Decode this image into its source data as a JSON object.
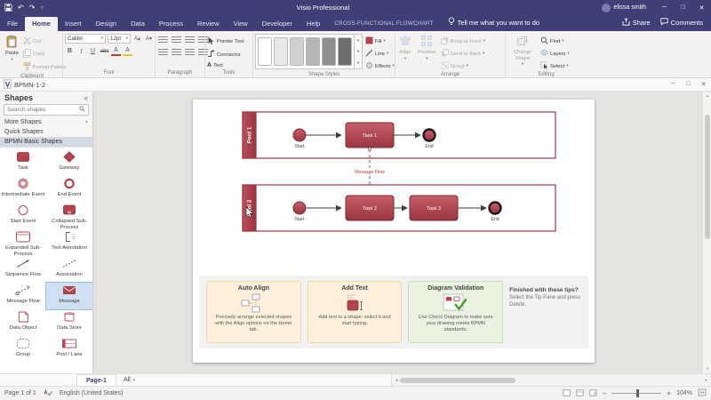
{
  "colors": {
    "accent": "#3f3e75",
    "bpmn_red": "#b5434e",
    "canvas_bg": "#e5e3e0",
    "tip_orange_bg": "#fcefdc",
    "tip_green_bg": "#e9f3df"
  },
  "title_bar": {
    "app_title": "Visio Professional",
    "user_name": "elissa smith"
  },
  "tabs": {
    "file": "File",
    "items": [
      "Home",
      "Insert",
      "Design",
      "Data",
      "Process",
      "Review",
      "View",
      "Developer",
      "Help"
    ],
    "contextual": "CROSS-FUNCTIONAL FLOWCHART",
    "tell_me": "Tell me what you want to do",
    "share": "Share",
    "comments": "Comments"
  },
  "ribbon": {
    "clipboard": {
      "label": "Clipboard",
      "paste": "Paste",
      "cut": "Cut",
      "copy": "Copy",
      "format_painter": "Format Painter"
    },
    "font": {
      "label": "Font",
      "family": "Calibri",
      "size": "12pt",
      "bold": "B",
      "italic": "I",
      "underline": "U",
      "strike": "abc",
      "color_a": "A"
    },
    "paragraph": {
      "label": "Paragraph"
    },
    "tools": {
      "label": "Tools",
      "pointer": "Pointer Tool",
      "connector": "Connector",
      "text": "Text"
    },
    "shape_styles": {
      "label": "Shape Styles",
      "fill": "Fill",
      "line": "Line",
      "effects": "Effects"
    },
    "arrange": {
      "label": "Arrange",
      "align": "Align",
      "position": "Position",
      "bring_to_front": "Bring to Front",
      "send_to_back": "Send to Back",
      "group": "Group"
    },
    "editing": {
      "label": "Editing",
      "change_shape": "Change Shape",
      "find": "Find",
      "layers": "Layers",
      "select": "Select"
    }
  },
  "doc_window": {
    "title": "BPMN-1-2"
  },
  "shapes_panel": {
    "title": "Shapes",
    "search_placeholder": "Search shapes",
    "more_shapes": "More Shapes",
    "quick_shapes": "Quick Shapes",
    "stencil_title": "BPMN Basic Shapes",
    "items": [
      "Task",
      "Gateway",
      "Intermediate Event",
      "End Event",
      "Start Event",
      "Collapsed Sub-Process",
      "Expanded Sub-Process",
      "Text Annotation",
      "Sequence Flow",
      "Association",
      "Message Flow",
      "Message",
      "Data Object",
      "Data Store",
      "Group",
      "Pool / Lane"
    ]
  },
  "diagram": {
    "pool1": {
      "name": "Pool 1",
      "start": "Start",
      "task1": "Task 1",
      "end": "End"
    },
    "pool2": {
      "name": "Pool 2",
      "start": "Start",
      "task2": "Task 2",
      "task3": "Task 3",
      "end": "End"
    },
    "message_flow_label": "Message Flow"
  },
  "tips": {
    "cards": [
      {
        "title": "Auto Align",
        "body": "Precisely arrange selected shapes with the Align options on the Home tab."
      },
      {
        "title": "Add Text",
        "body": "Add text to a shape: select it and start typing."
      },
      {
        "title": "Diagram Validation",
        "body": "Use Check Diagram to make sure your drawing meets BPMN standards."
      }
    ],
    "outro_title": "Finished with these tips?",
    "outro_body": "Select the Tip Pane and press Delete."
  },
  "page_bar": {
    "page_tab": "Page-1",
    "all": "All"
  },
  "status_bar": {
    "page_info": "Page 1 of 1",
    "language": "English (United States)",
    "zoom": "104%"
  }
}
